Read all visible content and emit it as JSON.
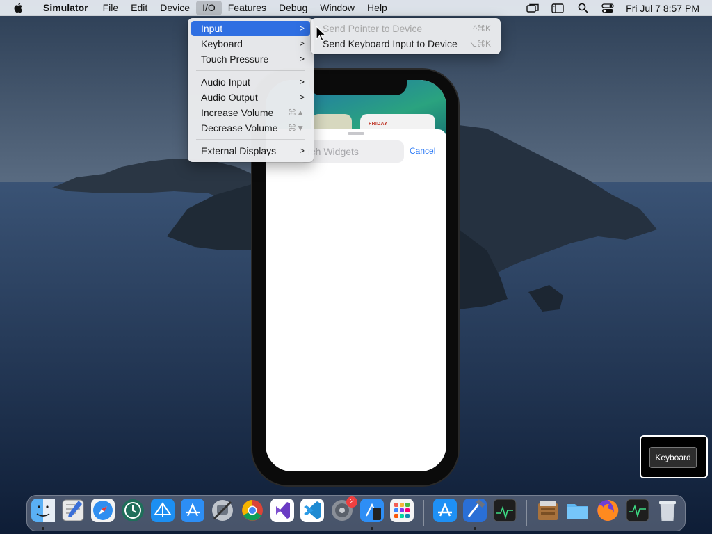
{
  "menubar": {
    "app_name": "Simulator",
    "menus": [
      "File",
      "Edit",
      "Device",
      "I/O",
      "Features",
      "Debug",
      "Window",
      "Help"
    ],
    "active_menu": "I/O",
    "clock": "Fri Jul 7  8:57 PM"
  },
  "io_menu": {
    "items": [
      {
        "label": "Input",
        "has_submenu": true,
        "selected": true
      },
      {
        "label": "Keyboard",
        "has_submenu": true
      },
      {
        "label": "Touch Pressure",
        "has_submenu": true
      },
      {
        "label": "Audio Input",
        "has_submenu": true
      },
      {
        "label": "Audio Output",
        "has_submenu": true
      },
      {
        "label": "Increase Volume",
        "shortcut": "⌘▲"
      },
      {
        "label": "Decrease Volume",
        "shortcut": "⌘▼"
      },
      {
        "label": "External Displays",
        "has_submenu": true
      }
    ],
    "chevron": ">"
  },
  "input_submenu": {
    "items": [
      {
        "label": "Send Pointer to Device",
        "shortcut": "^⌘K",
        "disabled": true
      },
      {
        "label": "Send Keyboard Input to Device",
        "shortcut": "⌥⌘K",
        "disabled": false
      }
    ]
  },
  "device_screen": {
    "widget_day": "FRIDAY",
    "search_placeholder": "rch Widgets",
    "cancel_label": "Cancel"
  },
  "keyboard_overlay": {
    "label": "Keyboard"
  },
  "dock": {
    "apps": [
      "finder",
      "scripteditor",
      "safari",
      "timemachine",
      "testflight",
      "appstoreconnect",
      "automator",
      "chrome",
      "visualstudio",
      "vscode",
      "systempreferences",
      "simulator",
      "launchpad",
      "appstore",
      "xcode",
      "activitymonitor",
      "archiveutility",
      "folder",
      "firefox",
      "activitymonitor2",
      "trash"
    ],
    "badge_count": "2"
  },
  "colors": {
    "menu_highlight": "#2f6fe2",
    "cancel_blue": "#2f7cf6"
  }
}
